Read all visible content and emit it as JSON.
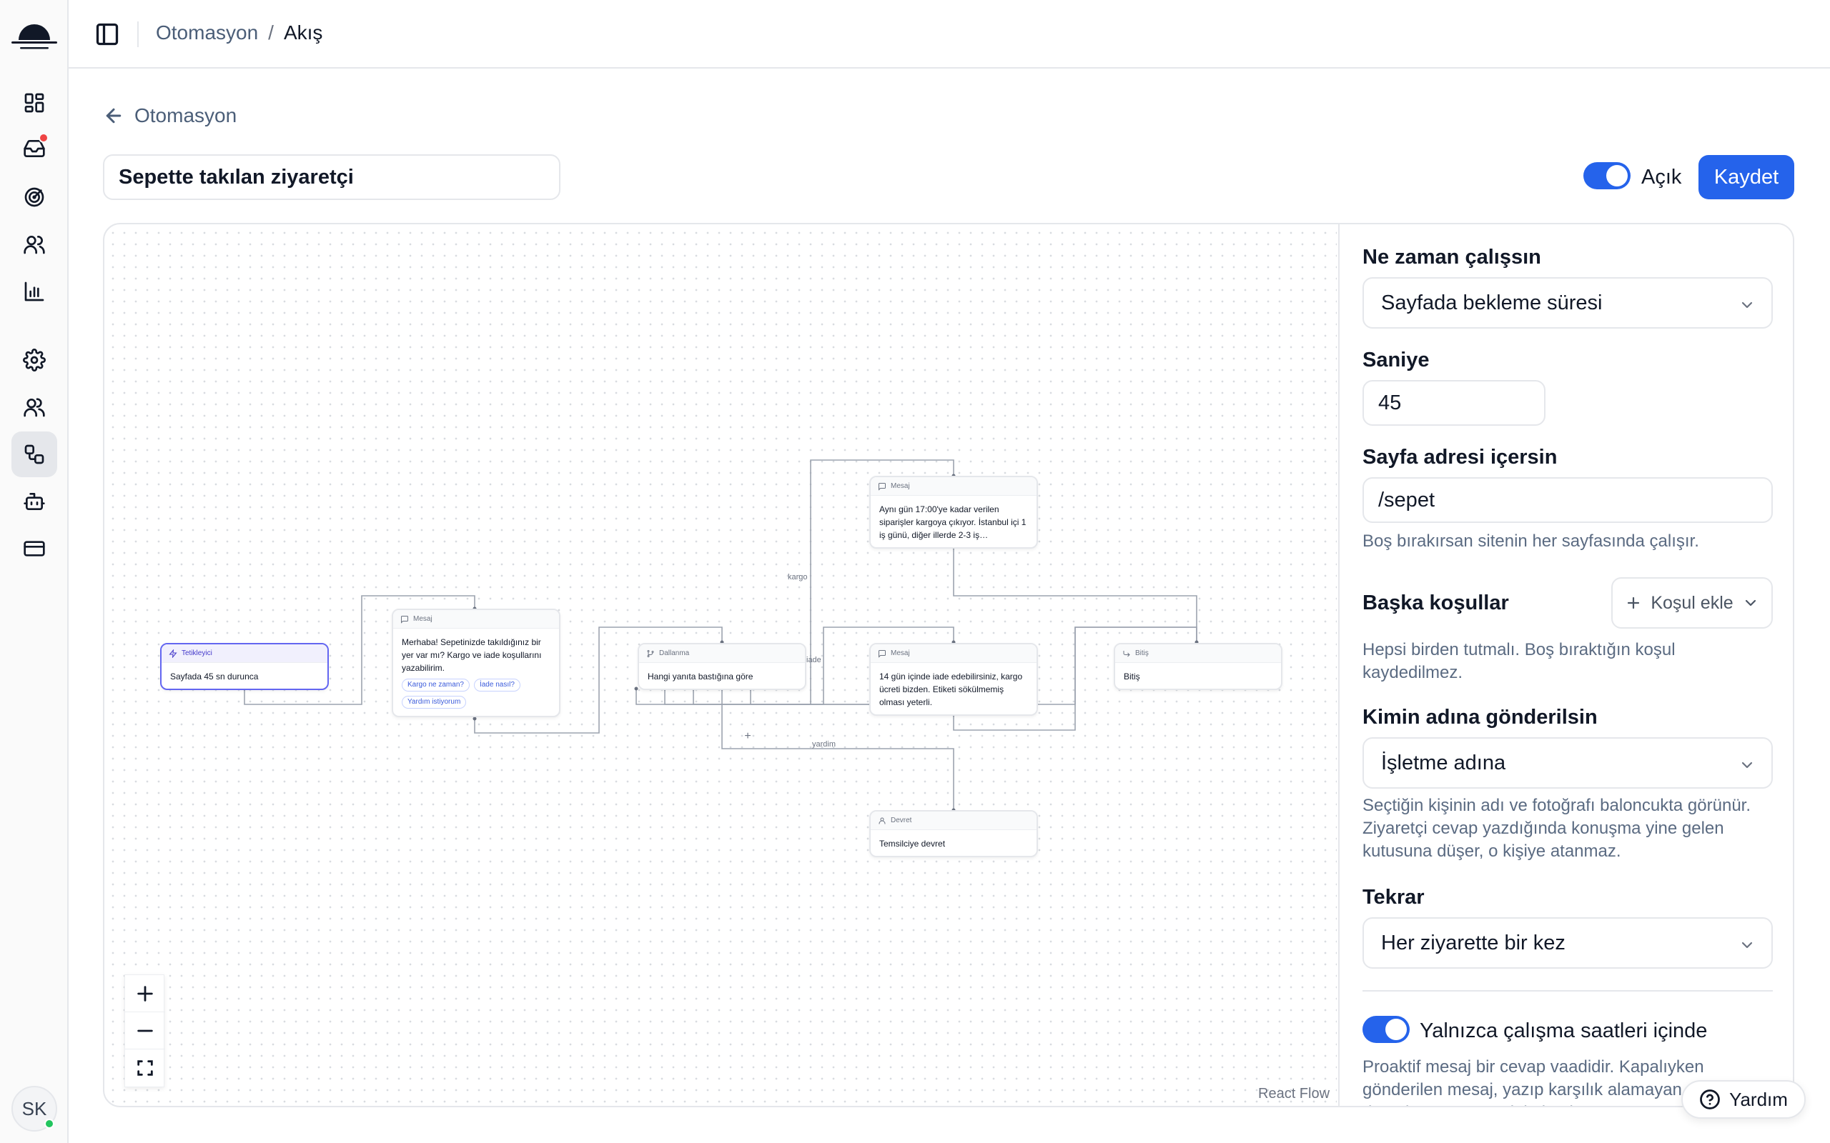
{
  "header": {
    "breadcrumb_parent": "Otomasyon",
    "breadcrumb_separator": "/",
    "breadcrumb_current": "Akış"
  },
  "back_link": {
    "label": "Otomasyon"
  },
  "flow": {
    "name": "Sepette takılan ziyaretçi",
    "enabled_label": "Açık",
    "save_label": "Kaydet"
  },
  "canvas": {
    "nodes": {
      "trigger": {
        "type": "Tetikleyici",
        "text": "Sayfada 45 sn durunca"
      },
      "message1": {
        "type": "Mesaj",
        "text": "Merhaba! Sepetinizde takıldığınız bir yer var mı? Kargo ve iade koşullarını yazabilirim.",
        "chips": [
          "Kargo ne zaman?",
          "İade nasıl?",
          "Yardım istiyorum"
        ]
      },
      "branch": {
        "type": "Dallanma",
        "text": "Hangi yanıta bastığına göre"
      },
      "message_cargo": {
        "type": "Mesaj",
        "text": "Aynı gün 17:00'ye kadar verilen siparişler kargoya çıkıyor. İstanbul içi 1 iş günü, diğer illerde 2-3 iş…"
      },
      "message_return": {
        "type": "Mesaj",
        "text": "14 gün içinde iade edebilirsiniz, kargo ücreti bizden. Etiketi sökülmemiş olması yeterli."
      },
      "end": {
        "type": "Bitiş",
        "text": "Bitiş"
      },
      "handoff": {
        "type": "Devret",
        "text": "Temsilciye devret"
      }
    },
    "edge_labels": {
      "cargo": "kargo",
      "return": "iade",
      "help": "yardim"
    },
    "attribution": "React Flow"
  },
  "settings": {
    "when_label": "Ne zaman çalışsın",
    "when_value": "Sayfada bekleme süresi",
    "seconds_label": "Saniye",
    "seconds_value": "45",
    "url_label": "Sayfa adresi içersin",
    "url_value": "/sepet",
    "url_help": "Boş bırakırsan sitenin her sayfasında çalışır.",
    "conditions_label": "Başka koşullar",
    "add_condition_label": "Koşul ekle",
    "conditions_help": "Hepsi birden tutmalı. Boş bıraktığın koşul kaydedilmez.",
    "sender_label": "Kimin adına gönderilsin",
    "sender_value": "İşletme adına",
    "sender_help": "Seçtiğin kişinin adı ve fotoğrafı baloncukta görünür. Ziyaretçi cevap yazdığında konuşma yine gelen kutusuna düşer, o kişiye atanmaz.",
    "repeat_label": "Tekrar",
    "repeat_value": "Her ziyarette bir kez",
    "business_hours_label": "Yalnızca çalışma saatleri içinde",
    "business_hours_help": "Proaktif mesaj bir cevap vaadidir. Kapalıyken gönderilen mesaj, yazıp karşılık alamayan ziyaretçi demek. Bu ayar açık kalmalı."
  },
  "user": {
    "initials": "SK"
  },
  "help_button": {
    "label": "Yardım"
  },
  "colors": {
    "accent": "#2563eb",
    "notification": "#ef4444",
    "online": "#22c55e"
  }
}
